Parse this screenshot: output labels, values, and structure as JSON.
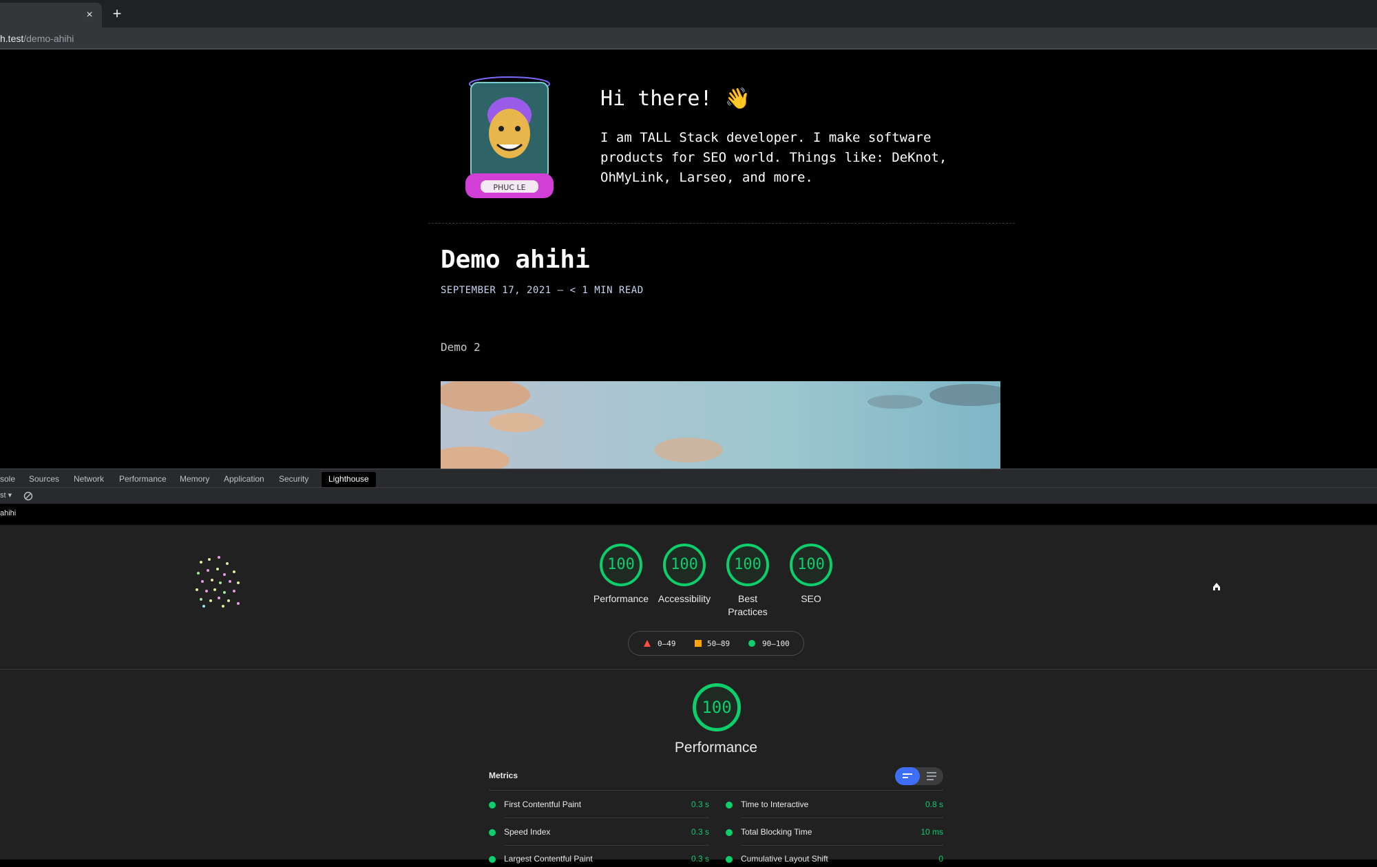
{
  "browser": {
    "tab_close": "×",
    "new_tab": "+",
    "url_host": "h.test",
    "url_path": "/demo-ahihi"
  },
  "page": {
    "greeting": "Hi there! 👋",
    "intro": "I am TALL Stack developer. I make software products for SEO world. Things like: DeKnot, OhMyLink, Larseo, and more.",
    "avatar_caption": "PHUC LE",
    "post_title": "Demo ahihi",
    "post_meta": "SEPTEMBER 17, 2021 — < 1 MIN READ",
    "post_body": "Demo 2"
  },
  "devtools": {
    "tabs": [
      "sole",
      "Sources",
      "Network",
      "Performance",
      "Memory",
      "Application",
      "Security",
      "Lighthouse"
    ],
    "active_tab": "Lighthouse",
    "toolbar_select": "st",
    "report_url": "ahihi"
  },
  "lighthouse": {
    "scores": [
      {
        "label": "Performance",
        "value": "100"
      },
      {
        "label": "Accessibility",
        "value": "100"
      },
      {
        "label": "Best Practices",
        "value": "100"
      },
      {
        "label": "SEO",
        "value": "100"
      }
    ],
    "legend": {
      "fail": "0–49",
      "average": "50–89",
      "pass": "90–100"
    },
    "section_score": "100",
    "section_title": "Performance",
    "metrics_heading": "Metrics",
    "metrics_left": [
      {
        "name": "First Contentful Paint",
        "value": "0.3 s"
      },
      {
        "name": "Speed Index",
        "value": "0.3 s"
      },
      {
        "name": "Largest Contentful Paint",
        "value": "0.3 s"
      }
    ],
    "metrics_right": [
      {
        "name": "Time to Interactive",
        "value": "0.8 s"
      },
      {
        "name": "Total Blocking Time",
        "value": "10 ms"
      },
      {
        "name": "Cumulative Layout Shift",
        "value": "0"
      }
    ],
    "colors": {
      "pass": "#0cce6b",
      "average": "#ffa400",
      "fail": "#ff4e42",
      "toggle": "#3e6ef5"
    }
  }
}
